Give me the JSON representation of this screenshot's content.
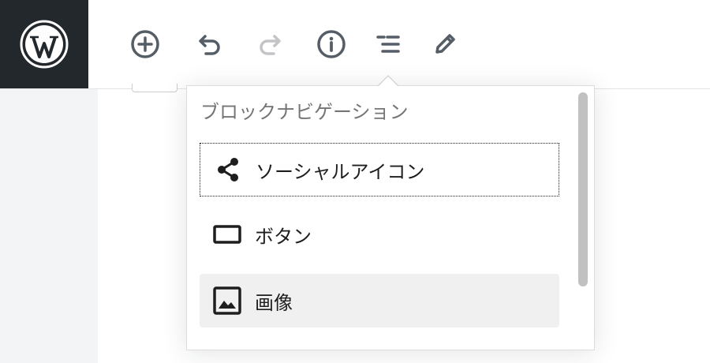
{
  "toolbar": {
    "logo_icon": "wordpress-logo-icon",
    "buttons": [
      {
        "name": "add-block",
        "icon": "plus-circle-icon",
        "color": "#555d66"
      },
      {
        "name": "undo",
        "icon": "undo-icon",
        "color": "#555d66"
      },
      {
        "name": "redo",
        "icon": "redo-icon",
        "color": "#c3c4c7"
      },
      {
        "name": "info",
        "icon": "info-icon",
        "color": "#555d66"
      },
      {
        "name": "block-navigation",
        "icon": "list-view-icon",
        "color": "#555d66"
      },
      {
        "name": "tools",
        "icon": "pencil-icon",
        "color": "#555d66"
      }
    ]
  },
  "popover": {
    "title": "ブロックナビゲーション",
    "items": [
      {
        "label": "ソーシャルアイコン",
        "icon": "share-icon",
        "state": "focused"
      },
      {
        "label": "ボタン",
        "icon": "button-icon",
        "state": "normal"
      },
      {
        "label": "画像",
        "icon": "image-icon",
        "state": "selected"
      }
    ]
  },
  "colors": {
    "logo_background": "#23282d",
    "sidebar_background": "#f3f4f5",
    "selected_item_background": "#f0f0f0",
    "scrollbar_thumb": "#c1c1c1"
  }
}
